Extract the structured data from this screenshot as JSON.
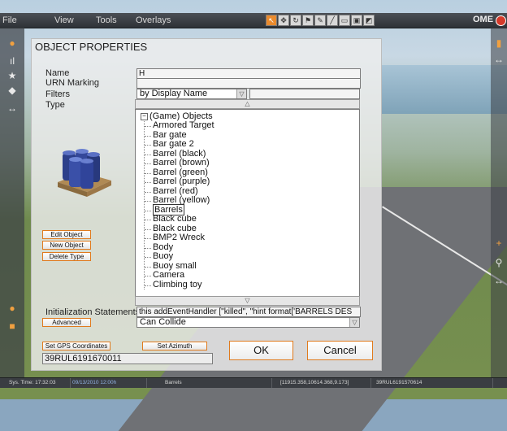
{
  "menubar": {
    "items": [
      "File",
      "View",
      "Tools",
      "Overlays"
    ],
    "logo": "OME"
  },
  "dialog": {
    "title": "OBJECT PROPERTIES",
    "labels": {
      "name": "Name",
      "urn": "URN Marking",
      "filters": "Filters",
      "type": "Type",
      "init": "Initialization Statements"
    },
    "name_value": "H",
    "urn_value": "",
    "filter_selected": "by Display Name",
    "filter_search": "",
    "tree": {
      "root": "(Game) Objects",
      "items": [
        "Armored Target",
        "Bar gate",
        "Bar gate 2",
        "Barrel (black)",
        "Barrel (brown)",
        "Barrel (green)",
        "Barrel (purple)",
        "Barrel (red)",
        "Barrel (yellow)",
        "Barrels",
        "Black cube",
        "Black cube",
        "BMP2 Wreck",
        "Body",
        "Buoy",
        "Buoy small",
        "Camera",
        "Climbing toy"
      ],
      "selected": "Barrels"
    },
    "buttons": {
      "edit": "Edit Object",
      "new": "New Object",
      "delete": "Delete Type",
      "advanced": "Advanced",
      "gps": "Set GPS Coordinates",
      "azimuth": "Set Azimuth",
      "ok": "OK",
      "cancel": "Cancel"
    },
    "init_value": "this addEventHandler [\"killed\", \"hint format['BARRELS DES",
    "collide_selected": "Can Collide",
    "gps_value": "39RUL6191670011"
  },
  "statusbar": {
    "sys_time": "Sys. Time: 17:32:03",
    "date": "09/13/2010 12:00h",
    "object": "Barrels",
    "coords": "[11915.358,10614.368,9.173]",
    "grid": "39RUL6191570614"
  },
  "colors": {
    "accent": "#e07a1d",
    "logo_red": "#d43a2a"
  }
}
